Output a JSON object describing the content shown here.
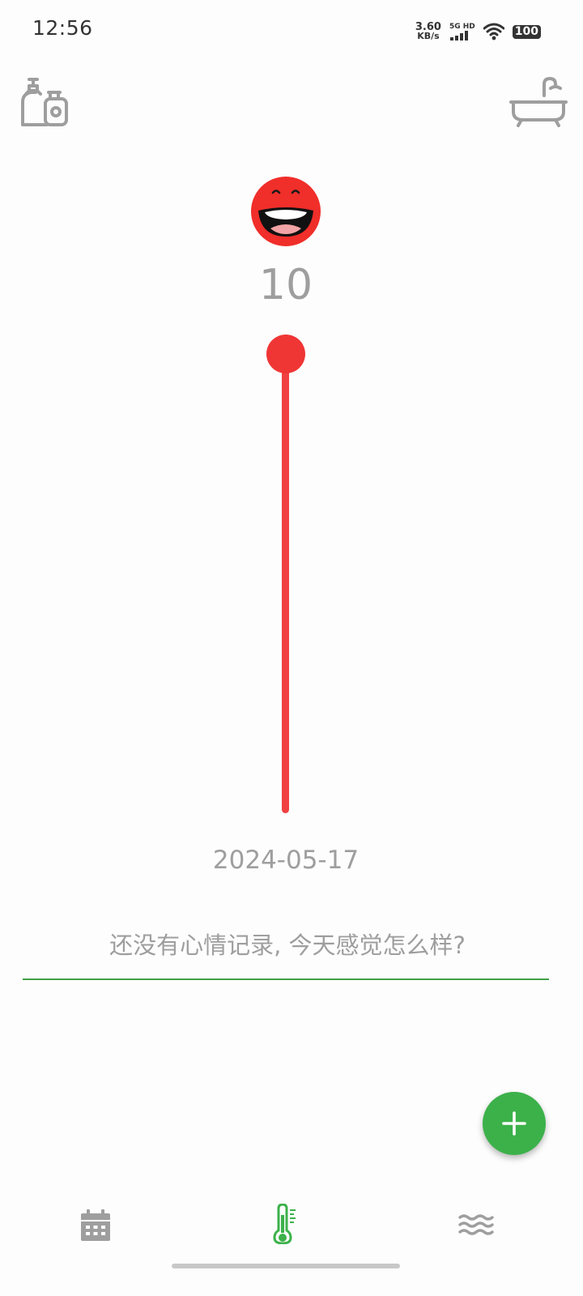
{
  "status_bar": {
    "time": "12:56",
    "net_speed_value": "3.60",
    "net_speed_unit": "KB/s",
    "signal_label": "5G HD",
    "battery": "100"
  },
  "header": {
    "left_icon": "toiletries-icon",
    "right_icon": "bathtub-icon"
  },
  "mood": {
    "emoji": "laughing-face-icon",
    "value": "10",
    "slider_value_fraction": 1.0,
    "date": "2024-05-17",
    "input_placeholder": "还没有心情记录, 今天感觉怎么样?",
    "input_value": ""
  },
  "fab": {
    "icon": "plus-icon"
  },
  "bottom_nav": {
    "items": [
      {
        "icon": "calendar-icon",
        "active": false
      },
      {
        "icon": "thermometer-icon",
        "active": true
      },
      {
        "icon": "waves-icon",
        "active": false
      }
    ]
  },
  "colors": {
    "accent": "#3cb14a",
    "mood_red": "#f03535",
    "icon_gray": "#9e9e9e"
  }
}
